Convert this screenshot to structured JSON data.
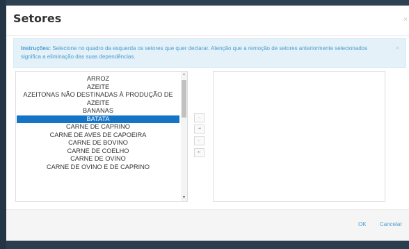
{
  "modal": {
    "title": "Setores",
    "close_icon": "×"
  },
  "alert": {
    "label": "Instruções:",
    "text": " Selecione no quadro da esquerda os setores que quer declarar. Atenção que a remoção de setores anteriormente selecionados significa a eliminação das suas dependências.",
    "close_icon": "×"
  },
  "available_sectors": {
    "items": [
      "ARROZ",
      "AZEITE",
      "AZEITONAS NÃO DESTINADAS À PRODUÇÃO DE AZEITE",
      "BANANAS",
      "BATATA",
      "CARNE DE CAPRINO",
      "CARNE DE AVES DE CAPOEIRA",
      "CARNE DE BOVINO",
      "CARNE DE COELHO",
      "CARNE DE OVINO",
      "CARNE DE OVINO E DE CAPRINO"
    ],
    "selected_item": "BATATA",
    "scroll_up_icon": "▲",
    "scroll_down_icon": "▼"
  },
  "transfer_buttons": {
    "move_right": "→",
    "move_all_right": "⇥",
    "move_left": "←",
    "move_all_left": "⇤"
  },
  "selected_sectors": {
    "items": []
  },
  "footer": {
    "ok_label": "OK",
    "cancel_label": "Cancelar"
  },
  "colors": {
    "backdrop": "#2b3e50",
    "accent": "#1674c7",
    "alert_background": "#e4f1f9",
    "alert_text": "#4a9ccf"
  }
}
